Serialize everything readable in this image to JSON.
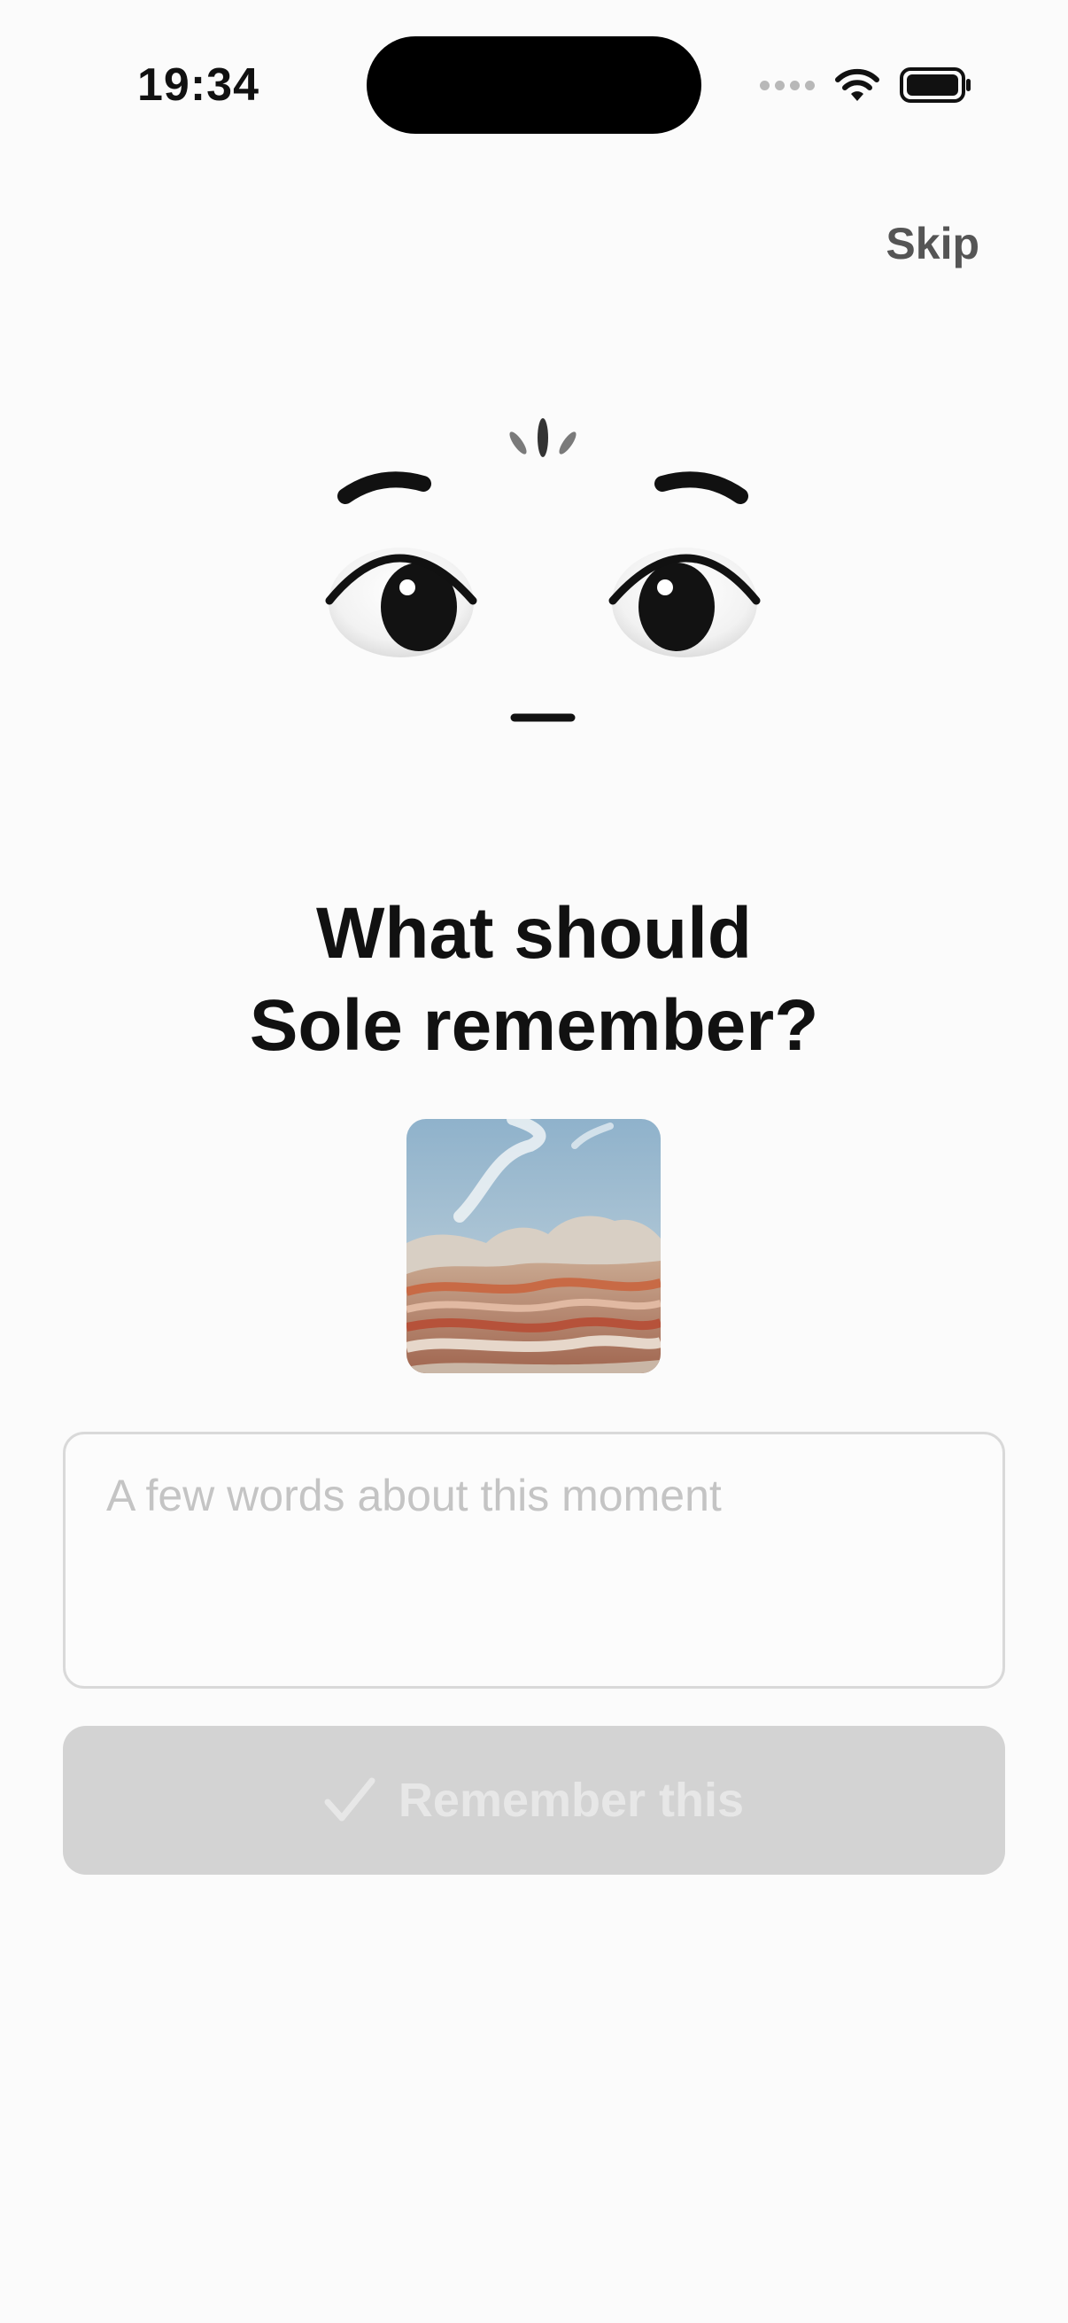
{
  "status_bar": {
    "time": "19:34",
    "icons": [
      "cellular-signal-icon",
      "wifi-icon",
      "battery-icon"
    ]
  },
  "header": {
    "skip_label": "Skip"
  },
  "mascot": {
    "icon": "sole-face-icon",
    "expression": "curious"
  },
  "prompt": {
    "title_line1": "What should",
    "title_line2": "Sole remember?"
  },
  "photo": {
    "description": "desert-rock-photo"
  },
  "note": {
    "value": "",
    "placeholder": "A few words about this moment"
  },
  "action": {
    "label": "Remember this",
    "icon": "check-icon",
    "enabled": false
  },
  "colors": {
    "background": "#fbfbfb",
    "text": "#111111",
    "button_disabled": "#d3d3d3",
    "button_text_disabled": "#e7e7e7"
  }
}
